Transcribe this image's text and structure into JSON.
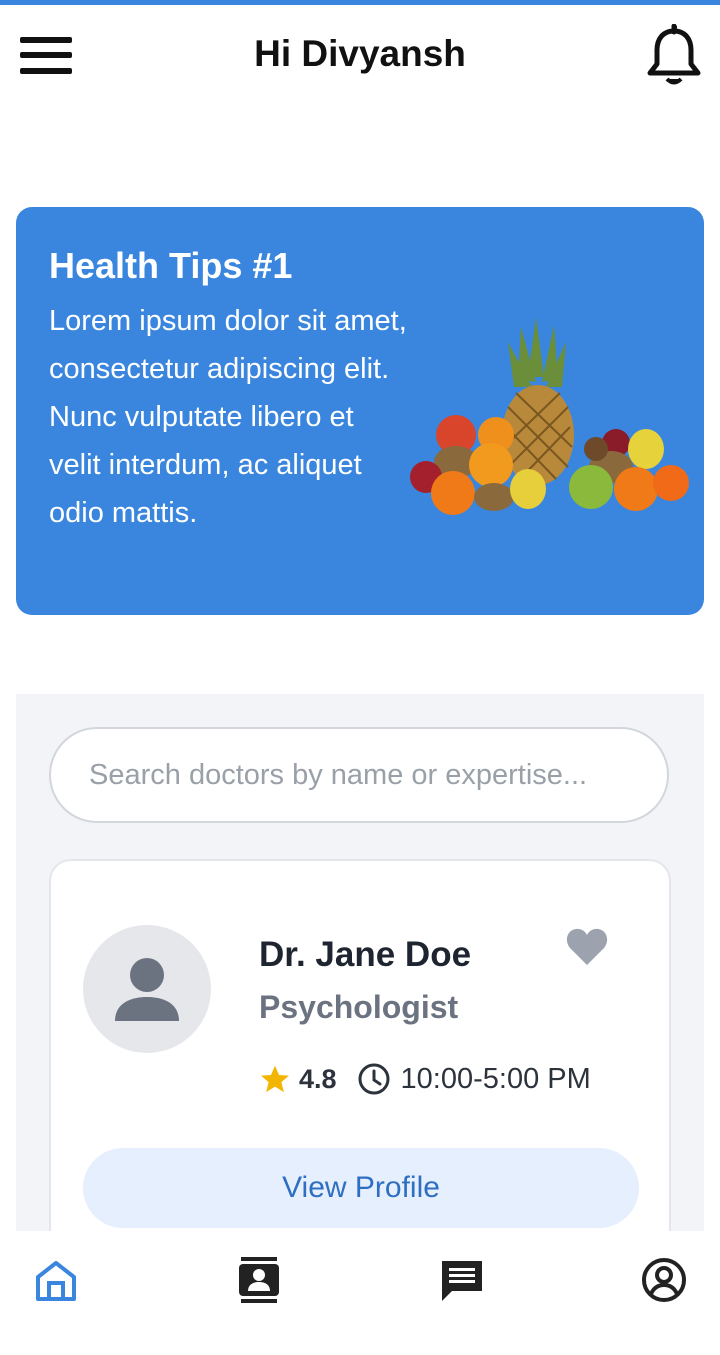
{
  "header": {
    "greeting": "Hi Divyansh",
    "menu_icon": "hamburger-menu-icon",
    "notification_icon": "bell-icon"
  },
  "health_tip": {
    "title": "Health Tips #1",
    "body": "Lorem ipsum dolor sit amet, consectetur adipiscing elit. Nunc vulputate libero et velit interdum, ac aliquet odio mattis.",
    "image": "fruit-pile-image"
  },
  "search": {
    "placeholder": "Search doctors by name or expertise..."
  },
  "doctor": {
    "name": "Dr. Jane Doe",
    "specialty": "Psychologist",
    "rating": "4.8",
    "hours": "10:00-5:00 PM",
    "view_profile_label": "View Profile",
    "avatar_icon": "person-placeholder-icon",
    "favorite_icon": "heart-icon"
  },
  "bottom_nav": {
    "items": [
      "home-icon",
      "contacts-icon",
      "chat-icon",
      "account-icon"
    ],
    "active": "home-icon"
  },
  "colors": {
    "accent": "#3a86de",
    "star": "#f2b600",
    "active_nav": "#3a86de",
    "text_dark": "#1f2530",
    "muted": "#6b7280"
  }
}
